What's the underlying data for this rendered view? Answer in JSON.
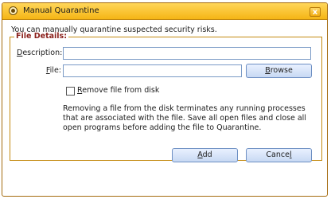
{
  "window": {
    "title": "Manual Quarantine",
    "close_glyph": "x"
  },
  "intro_text": "You can manually quarantine suspected security risks.",
  "group": {
    "legend": "File Details:",
    "description_label_underlined": "D",
    "description_label_rest": "escription:",
    "description_value": "",
    "file_label_underlined": "F",
    "file_label_rest": "ile:",
    "file_value": "",
    "browse_label_underlined": "B",
    "browse_label_rest": "rowse",
    "remove_label_underlined": "R",
    "remove_label_rest": "emove file from disk",
    "remove_checked": false,
    "explanation": "Removing a file from the disk terminates any running processes that are associated with the file. Save all open files and close all open programs before adding the file to Quarantine."
  },
  "buttons": {
    "add_underlined": "A",
    "add_rest": "dd",
    "cancel_prefix": "Cance",
    "cancel_underlined": "l"
  },
  "colors": {
    "title_bar": "#f5b515",
    "legend": "#8a1f1a",
    "button_border": "#6d8fc3"
  }
}
